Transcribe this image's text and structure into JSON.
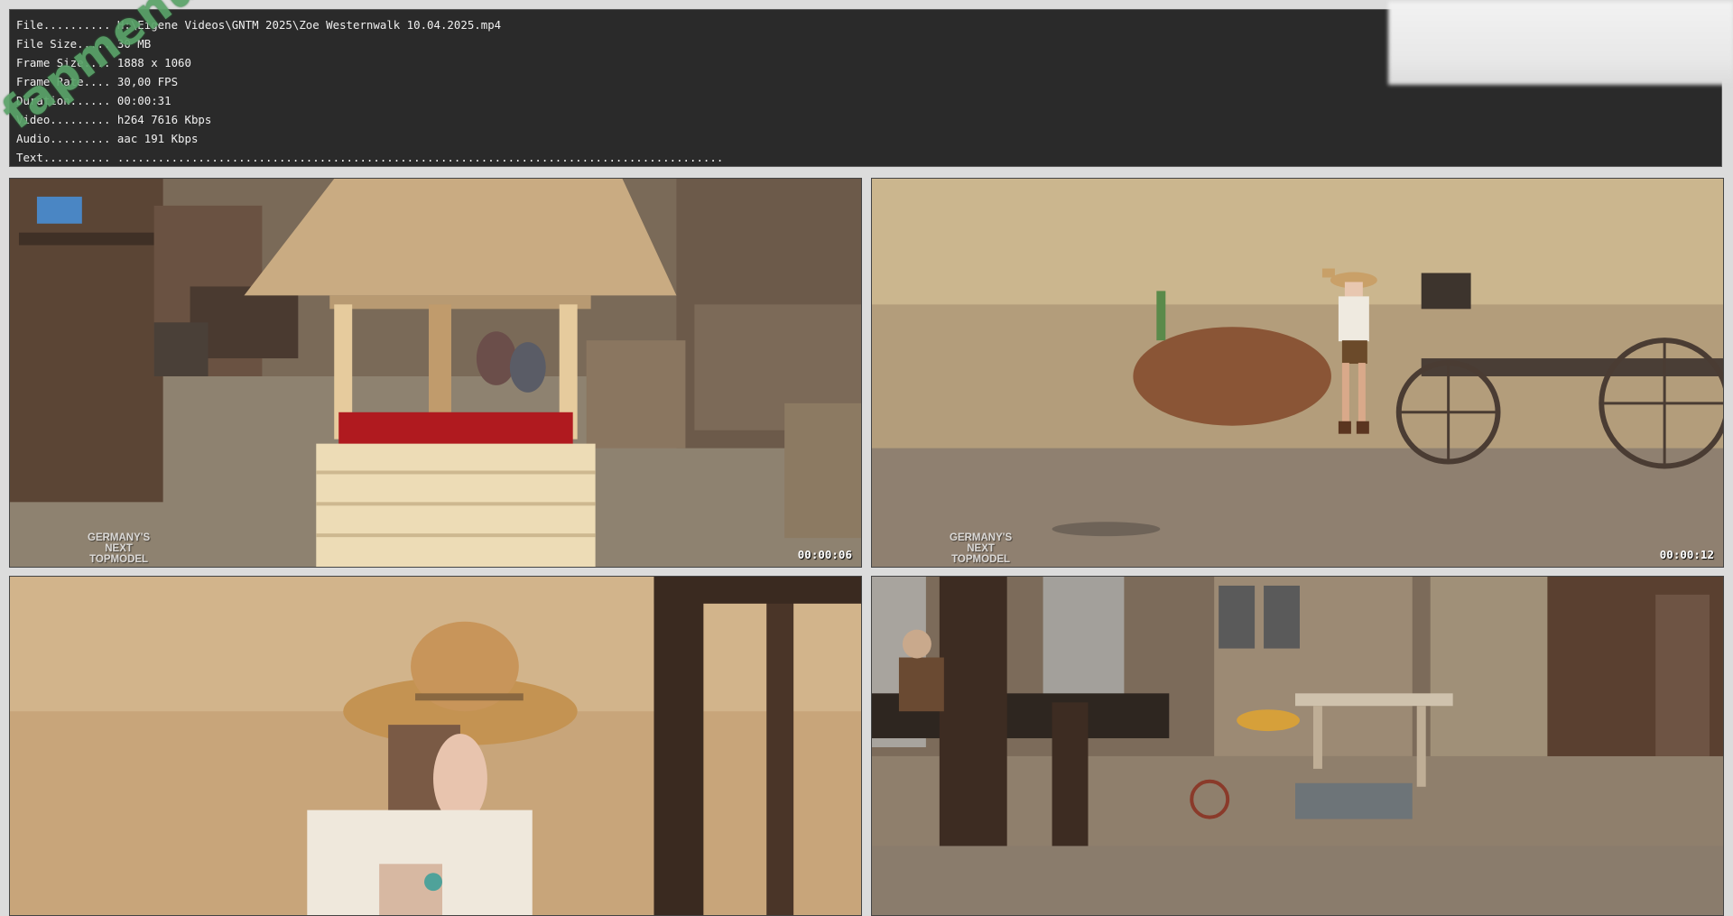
{
  "info": {
    "rows": [
      {
        "key": "File..........",
        "value": "H:\\Eigene Videos\\GNTM 2025\\Zoe Westernwalk 10.04.2025.mp4"
      },
      {
        "key": "File Size.....",
        "value": "30 MB"
      },
      {
        "key": "Frame Size....",
        "value": "1888 x 1060"
      },
      {
        "key": "Frame Rate....",
        "value": "30,00 FPS"
      },
      {
        "key": "Duration......",
        "value": "00:00:31"
      },
      {
        "key": "Video.........",
        "value": "h264 7616 Kbps"
      },
      {
        "key": "Audio.........",
        "value": "aac 191 Kbps"
      },
      {
        "key": "Text..........",
        "value": ".........................................................................................."
      }
    ]
  },
  "watermark": "fapmenu.com",
  "frames": [
    {
      "timestamp": "00:00:06",
      "logo": [
        "GERMANY'S",
        "NEXT",
        "TOPMODEL"
      ]
    },
    {
      "timestamp": "00:00:12",
      "logo": [
        "GERMANY'S",
        "NEXT",
        "TOPMODEL"
      ]
    },
    {
      "timestamp": "",
      "logo": []
    },
    {
      "timestamp": "",
      "logo": []
    }
  ]
}
